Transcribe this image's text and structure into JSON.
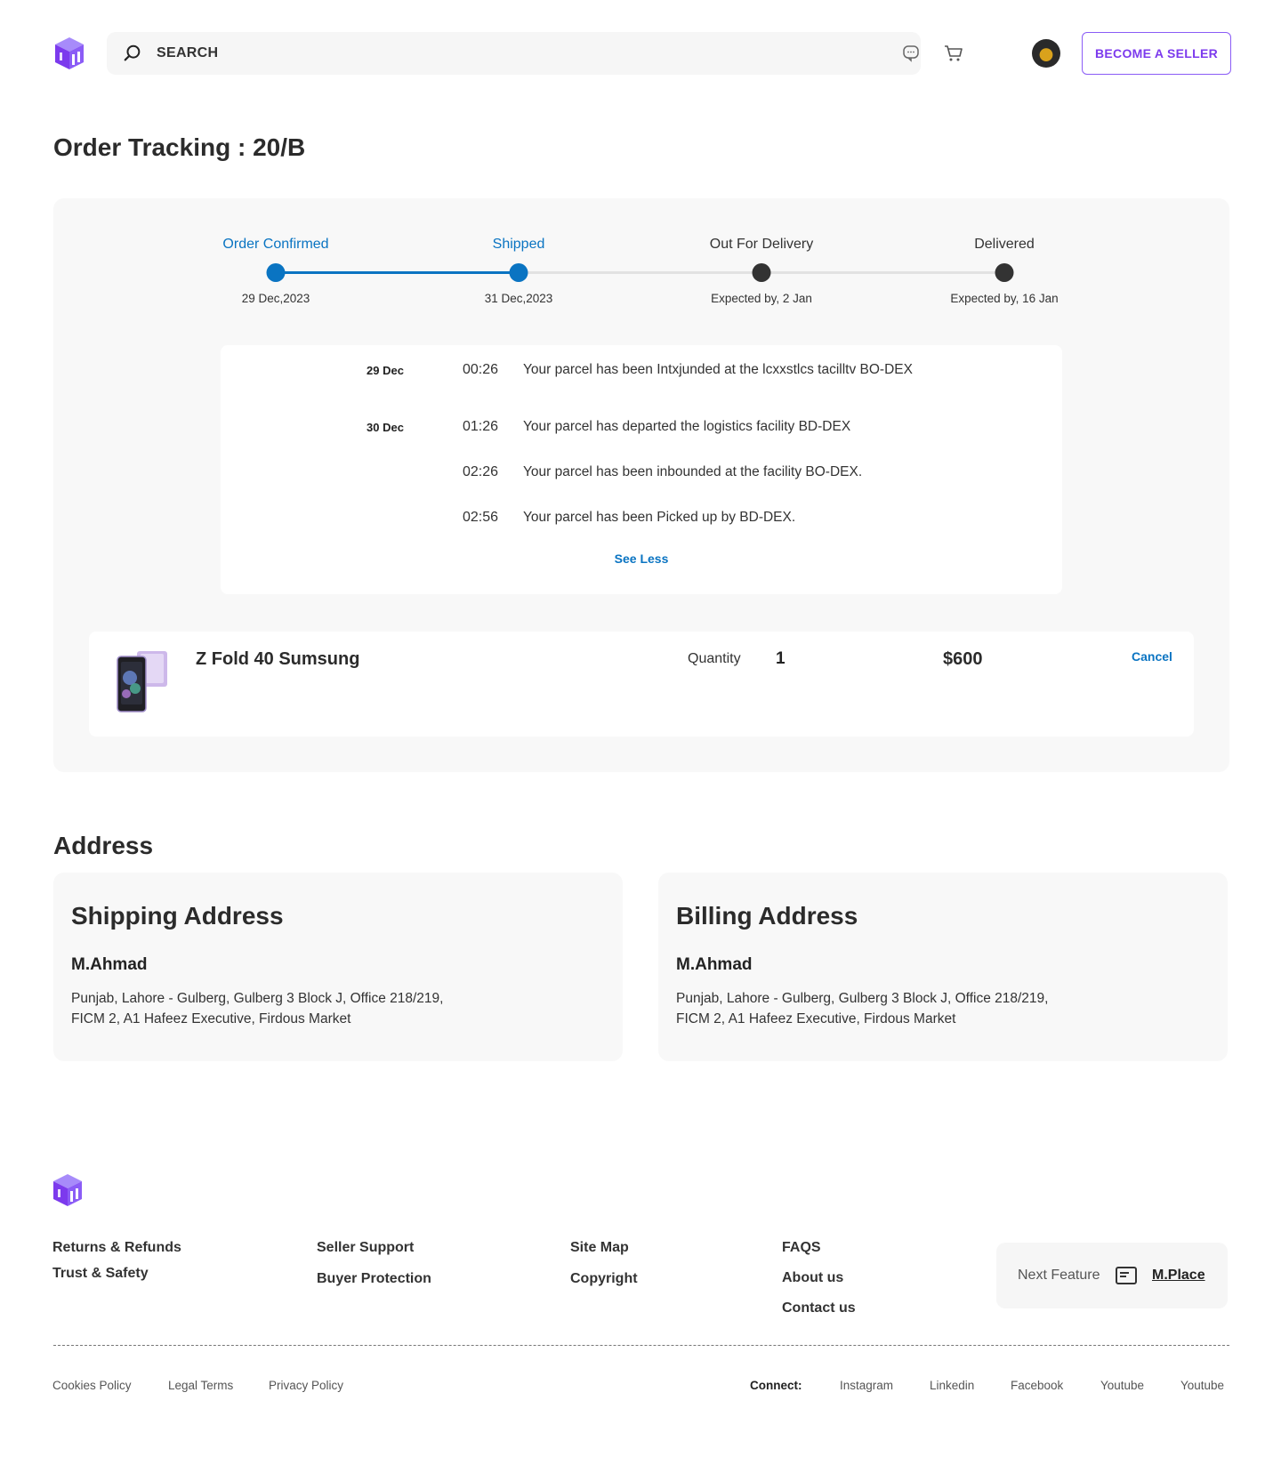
{
  "header": {
    "search_label": "SEARCH",
    "seller_button": "BECOME A SELLER",
    "accent_color": "#7c3aed",
    "icons": [
      "box-logo-icon",
      "search-icon",
      "chat-icon",
      "cart-icon",
      "avatar"
    ]
  },
  "page_title": "Order Tracking : 20/B",
  "tracking": {
    "progress_completed_stages": 2,
    "stages": [
      {
        "label": "Order Confirmed",
        "date": "29 Dec,2023",
        "active": true
      },
      {
        "label": "Shipped",
        "date": "31 Dec,2023",
        "active": true
      },
      {
        "label": "Out For Delivery",
        "date": "Expected by, 2 Jan",
        "active": false
      },
      {
        "label": "Delivered",
        "date": "Expected by, 16 Jan",
        "active": false
      }
    ],
    "events": [
      {
        "date": "29 Dec",
        "time": "00:26",
        "text": "Your parcel has been Intxjunded at the lcxxstlcs tacilltv BO-DEX"
      },
      {
        "date": "30 Dec",
        "time": "01:26",
        "text": "Your parcel has departed the logistics facility BD-DEX"
      },
      {
        "date": "",
        "time": "02:26",
        "text": "Your parcel has been inbounded at the facility BO-DEX."
      },
      {
        "date": "",
        "time": "02:56",
        "text": "Your parcel has been Picked up by BD-DEX."
      }
    ],
    "see_less": "See Less",
    "active_color": "#0a74c2"
  },
  "product": {
    "name": "Z Fold 40 Sumsung",
    "quantity_label": "Quantity",
    "quantity": "1",
    "price": "$600",
    "cancel": "Cancel"
  },
  "address": {
    "title": "Address",
    "shipping": {
      "heading": "Shipping Address",
      "name": "M.Ahmad",
      "line1": "Punjab, Lahore - Gulberg, Gulberg 3 Block J, Office 218/219,",
      "line2": "FICM 2, A1 Hafeez Executive, Firdous Market"
    },
    "billing": {
      "heading": "Billing Address",
      "name": "M.Ahmad",
      "line1": "Punjab, Lahore - Gulberg, Gulberg 3 Block J, Office 218/219,",
      "line2": "FICM 2, A1 Hafeez Executive, Firdous Market"
    }
  },
  "footer": {
    "col1": [
      "Returns & Refunds",
      "Trust & Safety"
    ],
    "col2": [
      "Seller Support",
      "Buyer Protection"
    ],
    "col3": [
      "Site Map",
      "Copyright"
    ],
    "col4": [
      "FAQS",
      "About us",
      "Contact us"
    ],
    "next_feature_label": "Next Feature",
    "next_feature_link": "M.Place",
    "bottom_links": [
      "Cookies Policy",
      "Legal Terms",
      "Privacy Policy"
    ],
    "connect_label": "Connect:",
    "social": [
      "Instagram",
      "Linkedin",
      "Facebook",
      "Youtube",
      "Youtube"
    ]
  }
}
